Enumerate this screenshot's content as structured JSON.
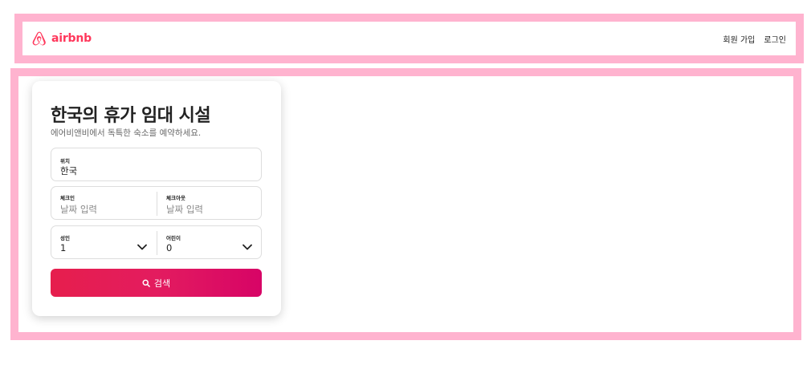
{
  "brand": {
    "name": "airbnb",
    "color": "#ff385c"
  },
  "header": {
    "nav": [
      {
        "label": "회원 가입"
      },
      {
        "label": "로그인"
      }
    ]
  },
  "search_card": {
    "title": "한국의 휴가 임대 시설",
    "subtitle": "에어비앤비에서 독특한 숙소를 예약하세요.",
    "location": {
      "label": "위치",
      "value": "한국"
    },
    "checkin": {
      "label": "체크인",
      "placeholder": "날짜 입력"
    },
    "checkout": {
      "label": "체크아웃",
      "placeholder": "날짜 입력"
    },
    "adults": {
      "label": "성인",
      "value": "1"
    },
    "children": {
      "label": "어린이",
      "value": "0"
    },
    "search_button": {
      "label": "검색",
      "icon": "search-icon"
    }
  },
  "colors": {
    "frame_border": "#ffb3cf",
    "button_gradient_start": "#e61e4d",
    "button_gradient_end": "#d70466"
  }
}
